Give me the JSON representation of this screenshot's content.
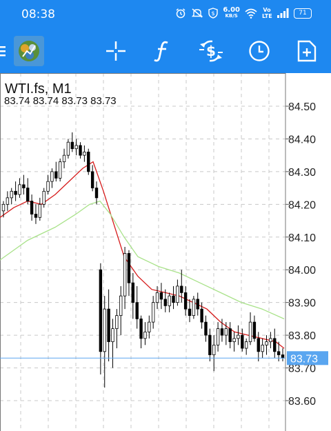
{
  "status_bar": {
    "time": "08:38",
    "net_speed": "6.00",
    "net_unit": "KB/S",
    "volte": "Vo LTE",
    "battery": "71",
    "icons": [
      "alarm-icon",
      "mute-icon",
      "shield-icon",
      "wifi-icon",
      "signal-icon"
    ]
  },
  "toolbar": {
    "buttons": [
      "menu-icon",
      "app-logo",
      "crosshair-icon",
      "indicator-function-icon",
      "trade-icon",
      "history-clock-icon",
      "new-order-icon"
    ]
  },
  "chart": {
    "symbol_label": "WTI.fs, M1",
    "ohlc_label": "83.74 83.74 83.73 83.73",
    "current_price": "83.73",
    "colors": {
      "candles": "#000000",
      "ma_fast": "#d61a1a",
      "ma_slow": "#a9e28a",
      "current_line": "#5aa6f0",
      "grid": "#c8c8c8"
    }
  },
  "chart_data": {
    "type": "candlestick",
    "y_ticks": [
      "84.50",
      "84.40",
      "84.30",
      "84.20",
      "84.10",
      "84.00",
      "83.90",
      "83.80",
      "83.70",
      "83.60"
    ],
    "ylim": [
      83.57,
      84.56
    ],
    "current_price": 83.73,
    "series": [
      {
        "name": "",
        "type": "line",
        "color": "#d61a1a",
        "x": [
          0,
          20,
          40,
          60,
          80,
          100,
          120,
          135,
          150,
          165,
          180,
          200,
          220,
          240,
          260,
          280,
          300,
          320,
          340,
          360,
          380,
          400,
          412
        ],
        "values": [
          84.16,
          84.19,
          84.21,
          84.2,
          84.23,
          84.27,
          84.31,
          84.33,
          84.24,
          84.14,
          84.04,
          83.98,
          83.94,
          83.93,
          83.92,
          83.9,
          83.88,
          83.84,
          83.81,
          83.8,
          83.79,
          83.78,
          83.76
        ]
      },
      {
        "name": "",
        "type": "line",
        "color": "#a9e28a",
        "x": [
          0,
          40,
          80,
          110,
          130,
          145,
          160,
          180,
          200,
          230,
          260,
          290,
          320,
          350,
          380,
          412
        ],
        "values": [
          84.03,
          84.09,
          84.13,
          84.17,
          84.2,
          84.21,
          84.17,
          84.1,
          84.04,
          84.01,
          83.99,
          83.96,
          83.93,
          83.9,
          83.88,
          83.85
        ]
      }
    ],
    "candles": [
      [
        84.18,
        84.21,
        84.16,
        84.2
      ],
      [
        84.2,
        84.24,
        84.18,
        84.22
      ],
      [
        84.22,
        84.25,
        84.2,
        84.24
      ],
      [
        84.24,
        84.27,
        84.21,
        84.23
      ],
      [
        84.23,
        84.28,
        84.22,
        84.26
      ],
      [
        84.26,
        84.29,
        84.23,
        84.25
      ],
      [
        84.25,
        84.28,
        84.2,
        84.21
      ],
      [
        84.21,
        84.23,
        84.15,
        84.17
      ],
      [
        84.17,
        84.2,
        84.14,
        84.16
      ],
      [
        84.16,
        84.22,
        84.15,
        84.2
      ],
      [
        84.2,
        84.25,
        84.19,
        84.24
      ],
      [
        84.24,
        84.29,
        84.23,
        84.27
      ],
      [
        84.27,
        84.31,
        84.25,
        84.3
      ],
      [
        84.3,
        84.33,
        84.27,
        84.28
      ],
      [
        84.28,
        84.34,
        84.27,
        84.33
      ],
      [
        84.33,
        84.37,
        84.31,
        84.35
      ],
      [
        84.35,
        84.4,
        84.34,
        84.39
      ],
      [
        84.39,
        84.42,
        84.36,
        84.37
      ],
      [
        84.37,
        84.4,
        84.35,
        84.38
      ],
      [
        84.38,
        84.39,
        84.34,
        84.35
      ],
      [
        84.35,
        84.38,
        84.33,
        84.36
      ],
      [
        84.36,
        84.37,
        84.29,
        84.3
      ],
      [
        84.3,
        84.32,
        84.24,
        84.25
      ],
      [
        84.25,
        84.27,
        84.2,
        84.22
      ],
      [
        84.0,
        84.02,
        83.68,
        83.75
      ],
      [
        83.75,
        83.92,
        83.64,
        83.88
      ],
      [
        83.88,
        83.94,
        83.72,
        83.78
      ],
      [
        83.78,
        83.85,
        83.7,
        83.82
      ],
      [
        83.82,
        83.88,
        83.76,
        83.86
      ],
      [
        83.86,
        83.95,
        83.8,
        83.92
      ],
      [
        83.92,
        84.07,
        83.88,
        84.05
      ],
      [
        84.05,
        84.06,
        83.92,
        83.96
      ],
      [
        83.96,
        83.99,
        83.85,
        83.9
      ],
      [
        83.9,
        83.95,
        83.82,
        83.85
      ],
      [
        83.85,
        83.86,
        83.76,
        83.79
      ],
      [
        83.79,
        83.84,
        83.77,
        83.81
      ],
      [
        83.81,
        83.86,
        83.79,
        83.84
      ],
      [
        83.84,
        83.92,
        83.82,
        83.9
      ],
      [
        83.9,
        83.95,
        83.88,
        83.93
      ],
      [
        83.93,
        83.96,
        83.88,
        83.91
      ],
      [
        83.91,
        83.94,
        83.87,
        83.89
      ],
      [
        83.89,
        83.93,
        83.87,
        83.92
      ],
      [
        83.92,
        83.95,
        83.88,
        83.9
      ],
      [
        83.9,
        83.97,
        83.89,
        83.95
      ],
      [
        83.95,
        84.0,
        83.9,
        83.93
      ],
      [
        83.93,
        83.95,
        83.86,
        83.88
      ],
      [
        83.88,
        83.91,
        83.84,
        83.86
      ],
      [
        83.86,
        83.92,
        83.85,
        83.91
      ],
      [
        83.91,
        83.93,
        83.86,
        83.88
      ],
      [
        83.88,
        83.9,
        83.82,
        83.84
      ],
      [
        83.84,
        83.86,
        83.78,
        83.8
      ],
      [
        83.8,
        83.82,
        83.72,
        83.74
      ],
      [
        83.74,
        83.8,
        83.69,
        83.77
      ],
      [
        83.77,
        83.84,
        83.75,
        83.82
      ],
      [
        83.82,
        83.85,
        83.78,
        83.8
      ],
      [
        83.8,
        83.84,
        83.77,
        83.82
      ],
      [
        83.82,
        83.84,
        83.76,
        83.78
      ],
      [
        83.78,
        83.81,
        83.75,
        83.79
      ],
      [
        83.79,
        83.83,
        83.77,
        83.8
      ],
      [
        83.8,
        83.82,
        83.75,
        83.76
      ],
      [
        83.76,
        83.79,
        83.74,
        83.78
      ],
      [
        83.78,
        83.87,
        83.77,
        83.84
      ],
      [
        83.84,
        83.86,
        83.78,
        83.79
      ],
      [
        83.79,
        83.81,
        83.72,
        83.75
      ],
      [
        83.75,
        83.79,
        83.73,
        83.77
      ],
      [
        83.77,
        83.8,
        83.74,
        83.78
      ],
      [
        83.78,
        83.81,
        83.76,
        83.79
      ],
      [
        83.79,
        83.82,
        83.73,
        83.75
      ],
      [
        83.75,
        83.78,
        83.72,
        83.74
      ],
      [
        83.74,
        83.76,
        83.72,
        83.73
      ]
    ]
  }
}
